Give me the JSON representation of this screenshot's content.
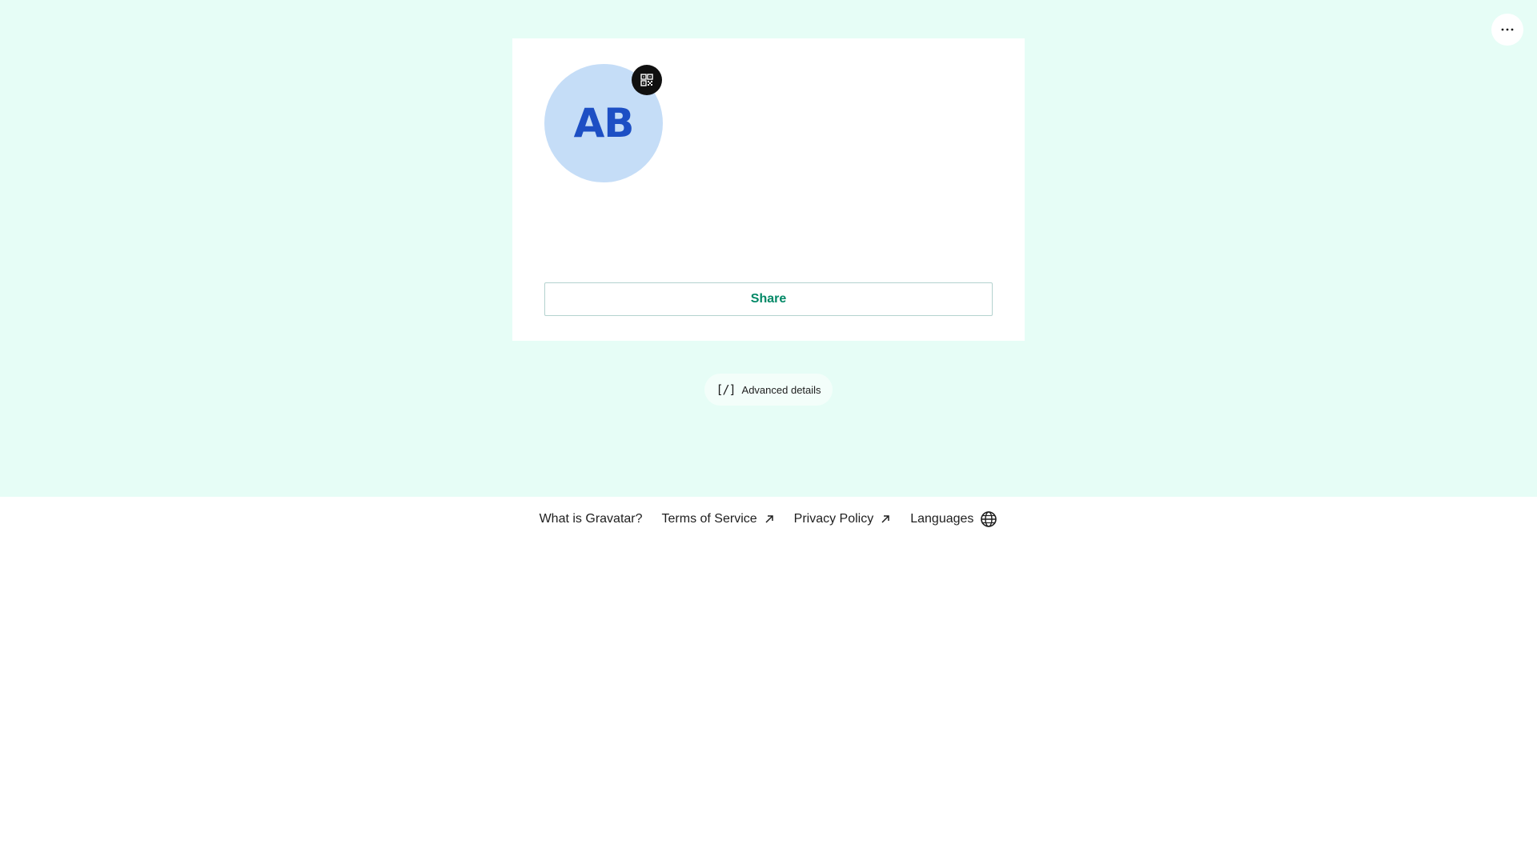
{
  "header": {
    "more_icon": "more-horizontal-icon"
  },
  "profile_card": {
    "avatar_initials": "AB",
    "avatar_background": "#c5ddf7",
    "avatar_text_color": "#1d4fc4",
    "qr_icon": "qr-code-icon",
    "share_label": "Share"
  },
  "advanced": {
    "icon": "code-icon",
    "icon_glyph": "[/]",
    "label": "Advanced details"
  },
  "footer": {
    "what_is": "What is Gravatar?",
    "terms": "Terms of Service",
    "privacy": "Privacy Policy",
    "languages": "Languages",
    "external_icon": "external-arrow-icon",
    "languages_icon": "globe-icon"
  },
  "colors": {
    "hero_background": "#e6fdf6",
    "accent": "#008866",
    "card_background": "#ffffff"
  }
}
